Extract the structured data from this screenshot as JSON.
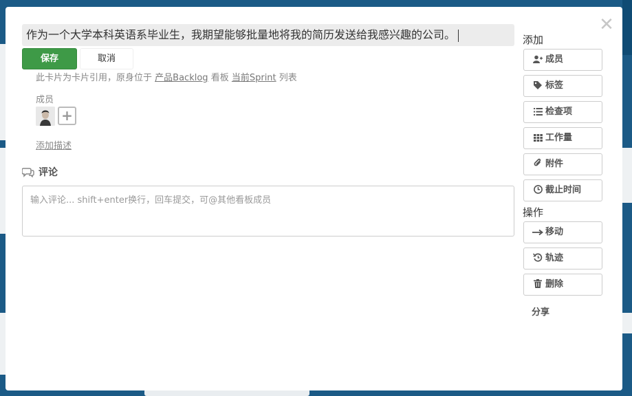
{
  "card": {
    "title": "作为一个大学本科英语系毕业生，我期望能够批量地将我的简历发送给我感兴趣的公司。",
    "save_label": "保存",
    "cancel_label": "取消",
    "ref_prefix": "此卡片为卡片引用，原身位于",
    "ref_board": "产品Backlog",
    "ref_board_suffix": "看板",
    "ref_list": "当前Sprint",
    "ref_list_suffix": "列表",
    "members_label": "成员",
    "add_description": "添加描述"
  },
  "comments": {
    "heading": "评论",
    "placeholder": "输入评论... shift+enter换行，回车提交，可@其他看板成员"
  },
  "sidebar": {
    "add_heading": "添加",
    "add_items": [
      {
        "label": "成员",
        "icon": "add-user-icon"
      },
      {
        "label": "标签",
        "icon": "tag-icon"
      },
      {
        "label": "检查项",
        "icon": "checklist-icon"
      },
      {
        "label": "工作量",
        "icon": "grid-icon"
      },
      {
        "label": "附件",
        "icon": "paperclip-icon"
      },
      {
        "label": "截止时间",
        "icon": "clock-icon"
      }
    ],
    "actions_heading": "操作",
    "action_items": [
      {
        "label": "移动",
        "icon": "arrow-right-icon"
      },
      {
        "label": "轨迹",
        "icon": "history-icon"
      },
      {
        "label": "删除",
        "icon": "trash-icon"
      }
    ],
    "share_label": "分享"
  },
  "colors": {
    "accent": "#3e9a47",
    "backdrop": "#1b5a86"
  }
}
